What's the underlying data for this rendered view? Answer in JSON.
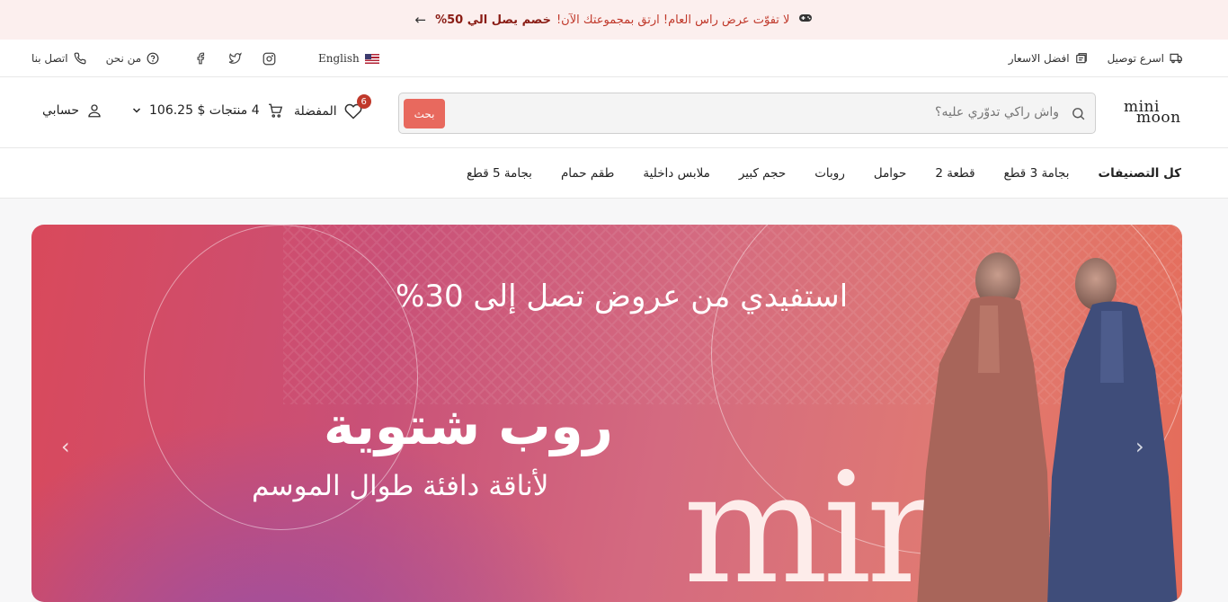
{
  "promo": {
    "text": "لا تفوّت عرض راس العام! ارتق بمجموعتك الآن!",
    "highlight": "خصم يصل الي 50%",
    "arrow": "←",
    "icon": "gamepad-icon"
  },
  "topbar": {
    "contact": "اتصل بنا",
    "about": "من نحن",
    "language": "English",
    "best_prices": "افضل الاسعار",
    "fast_delivery": "اسرع توصيل",
    "social": [
      "facebook-icon",
      "twitter-icon",
      "instagram-icon"
    ]
  },
  "header": {
    "account": "حسابي",
    "cart_summary": "4 منتجات $ 106.25",
    "wishlist": "المفضلة",
    "wishlist_count": "6",
    "search_button": "بحث",
    "search_placeholder": "واش راكي تدوّري عليه؟",
    "logo_line1": "mini",
    "logo_line2": "moon"
  },
  "nav": {
    "items": [
      "كل التصنيفات",
      "بجامة 3 قطع",
      "2 قطعة",
      "حوامل",
      "روبات",
      "حجم كبير",
      "ملابس داخلية",
      "طقم حمام",
      "بجامة 5 قطع"
    ]
  },
  "hero": {
    "subheading": "استفيدي من عروض تصل إلى 30%",
    "headline": "روب شتوية",
    "tagline": "لأناقة دافئة طوال الموسم",
    "brand_mark": "min",
    "prev_label": "‹",
    "next_label": "›"
  },
  "colors": {
    "accent": "#e8695e",
    "badge": "#c0392b",
    "promo_bg": "#fcefee"
  }
}
